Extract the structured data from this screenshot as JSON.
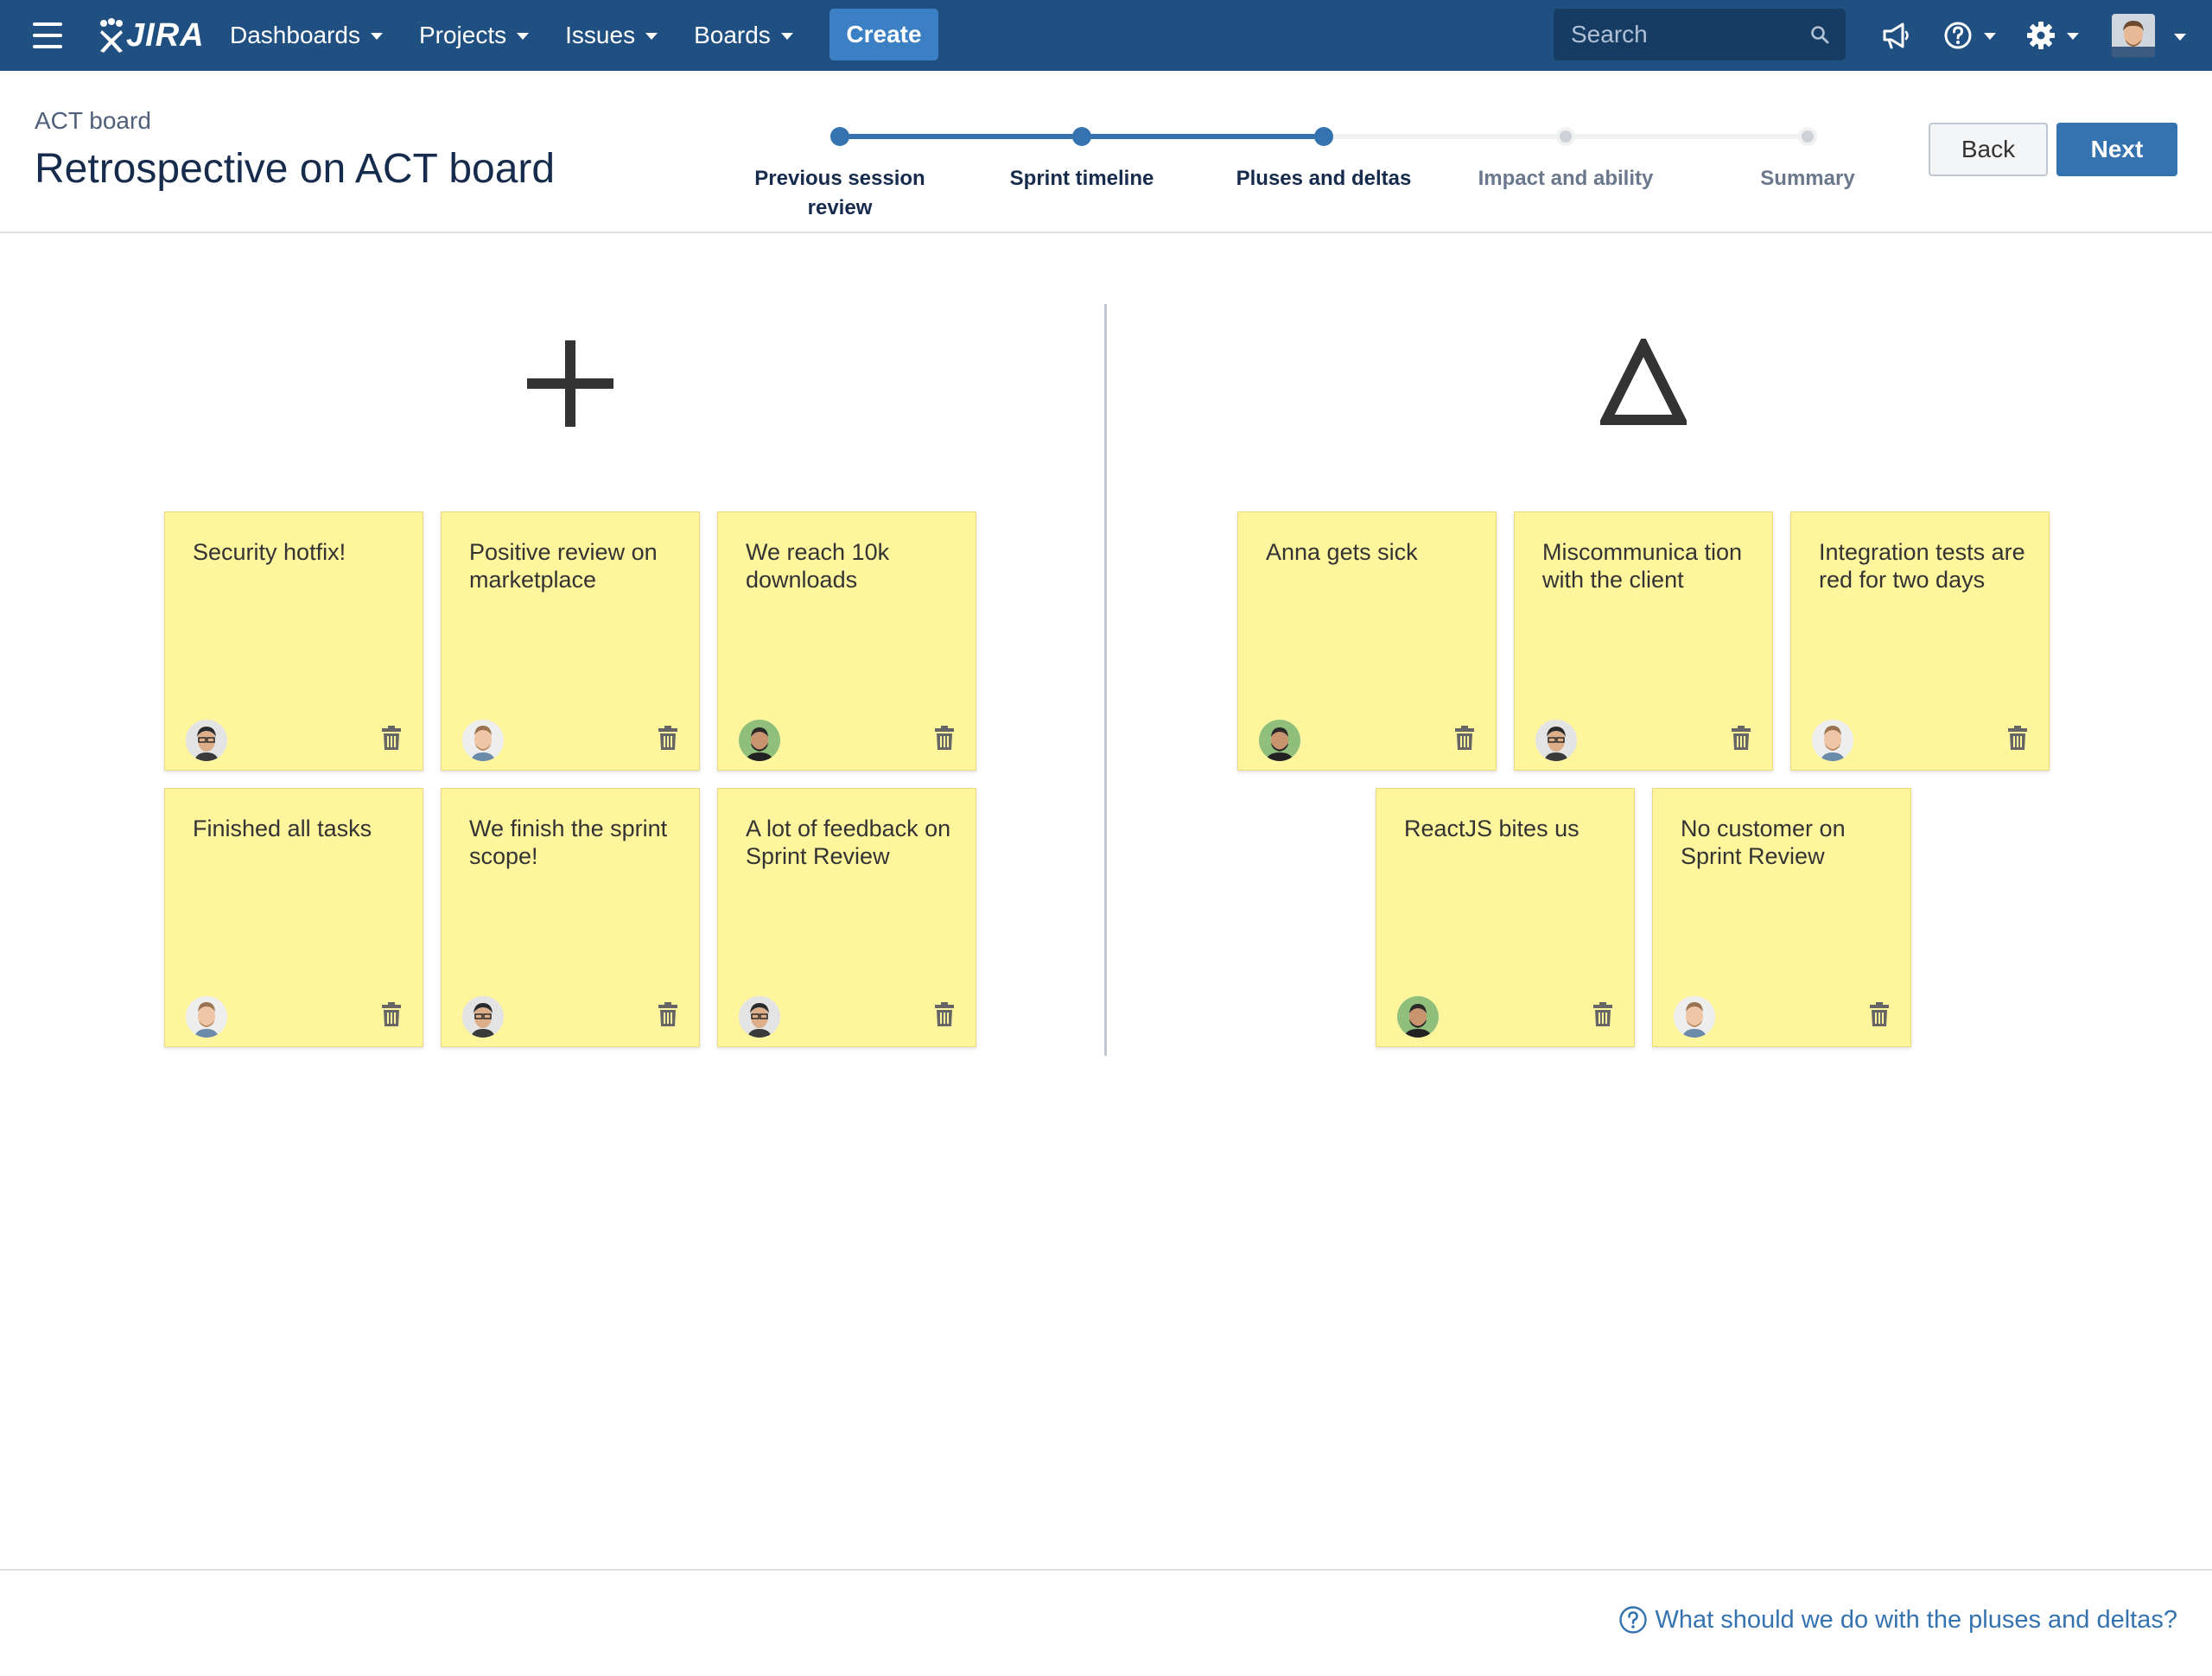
{
  "app": {
    "logo_text": "JIRA",
    "nav": [
      {
        "label": "Dashboards"
      },
      {
        "label": "Projects"
      },
      {
        "label": "Issues"
      },
      {
        "label": "Boards"
      }
    ],
    "create_label": "Create",
    "search_placeholder": "Search",
    "icons": [
      "menu-icon",
      "search-icon",
      "megaphone-icon",
      "help-icon",
      "gear-icon",
      "user-avatar"
    ]
  },
  "header": {
    "breadcrumb": "ACT board",
    "title": "Retrospective on ACT board",
    "steps": [
      {
        "label": "Previous session review",
        "state": "done"
      },
      {
        "label": "Sprint timeline",
        "state": "done"
      },
      {
        "label": "Pluses and deltas",
        "state": "current"
      },
      {
        "label": "Impact and ability",
        "state": "todo"
      },
      {
        "label": "Summary",
        "state": "todo"
      }
    ],
    "back_label": "Back",
    "next_label": "Next"
  },
  "columns": {
    "pluses": {
      "icon": "plus-icon",
      "notes": [
        {
          "text": "Security hotfix!",
          "author": "avatar-a"
        },
        {
          "text": "Positive review on marketplace",
          "author": "avatar-b"
        },
        {
          "text": "We reach 10k downloads",
          "author": "avatar-c"
        },
        {
          "text": "Finished all tasks",
          "author": "avatar-b"
        },
        {
          "text": "We finish the sprint scope!",
          "author": "avatar-a"
        },
        {
          "text": "A lot of feedback on Sprint Review",
          "author": "avatar-a"
        }
      ]
    },
    "deltas": {
      "icon": "delta-icon",
      "notes": [
        {
          "text": "Anna gets sick",
          "author": "avatar-c"
        },
        {
          "text": "Miscommunica tion with the client",
          "author": "avatar-a"
        },
        {
          "text": "Integration tests are red for two days",
          "author": "avatar-b"
        },
        {
          "text": "ReactJS bites us",
          "author": "avatar-c"
        },
        {
          "text": "No customer on Sprint Review",
          "author": "avatar-b"
        }
      ]
    }
  },
  "footer": {
    "help_link": "What should we do with the pluses and deltas?"
  },
  "colors": {
    "nav_bg": "#205081",
    "create_bg": "#3b7fc4",
    "primary": "#3572b0",
    "note_bg": "#fff59d",
    "step_done": "#3572b0",
    "step_todo": "#dfe1e5"
  }
}
